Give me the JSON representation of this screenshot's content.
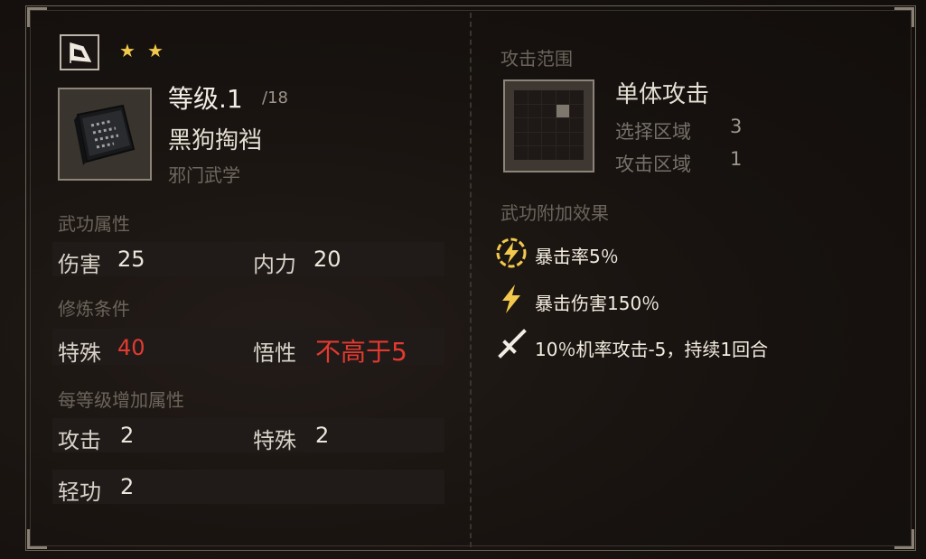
{
  "stars": 2,
  "level": {
    "label": "等级",
    "value": ".1",
    "max": "/18"
  },
  "item": {
    "name": "黑狗掏裆",
    "school": "邪门武学"
  },
  "sections": {
    "attributes": "武功属性",
    "requirements": "修炼条件",
    "per_level": "每等级增加属性",
    "attack_range": "攻击范围",
    "effects": "武功附加效果"
  },
  "attributes": [
    {
      "label": "伤害",
      "value": "25"
    },
    {
      "label": "内力",
      "value": "20"
    }
  ],
  "requirements": [
    {
      "label": "特殊",
      "value": "40"
    },
    {
      "label": "悟性",
      "value": "不高于5"
    }
  ],
  "per_level": [
    {
      "label": "攻击",
      "value": "2"
    },
    {
      "label": "特殊",
      "value": "2"
    },
    {
      "label": "轻功",
      "value": "2"
    }
  ],
  "range": {
    "type": "单体攻击",
    "select_label": "选择区域",
    "select_value": "3",
    "attack_label": "攻击区域",
    "attack_value": "1"
  },
  "effects": [
    {
      "icon": "lightning-circle-icon",
      "text": "暴击率5％"
    },
    {
      "icon": "lightning-icon",
      "text": "暴击伤害150％"
    },
    {
      "icon": "sword-icon",
      "text": "10％机率攻击-5，持续1回合"
    }
  ],
  "colors": {
    "highlight_red": "#e33a31",
    "star": "#f2c94c"
  }
}
